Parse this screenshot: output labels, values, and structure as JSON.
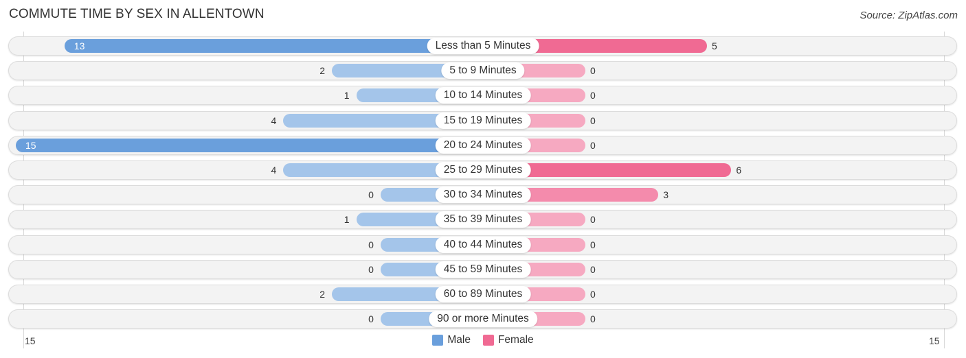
{
  "header": {
    "title": "COMMUTE TIME BY SEX IN ALLENTOWN",
    "source": "Source: ZipAtlas.com"
  },
  "colors": {
    "male": "#6a9fdc",
    "male_light": "#a4c5ea",
    "female": "#f06a93",
    "female_light": "#f6a9c1",
    "row_bg": "#f3f3f3"
  },
  "chart_data": {
    "type": "bar",
    "orientation": "horizontal-diverging",
    "title": "COMMUTE TIME BY SEX IN ALLENTOWN",
    "categories": [
      "Less than 5 Minutes",
      "5 to 9 Minutes",
      "10 to 14 Minutes",
      "15 to 19 Minutes",
      "20 to 24 Minutes",
      "25 to 29 Minutes",
      "30 to 34 Minutes",
      "35 to 39 Minutes",
      "40 to 44 Minutes",
      "45 to 59 Minutes",
      "60 to 89 Minutes",
      "90 or more Minutes"
    ],
    "series": [
      {
        "name": "Male",
        "values": [
          13,
          2,
          1,
          4,
          15,
          4,
          0,
          1,
          0,
          0,
          2,
          0
        ]
      },
      {
        "name": "Female",
        "values": [
          5,
          0,
          0,
          0,
          0,
          6,
          3,
          0,
          0,
          0,
          0,
          0
        ]
      }
    ],
    "xlim": [
      15,
      15
    ],
    "axis_ticks": {
      "left": "15",
      "right": "15"
    },
    "legend": {
      "position": "bottom-center",
      "entries": [
        "Male",
        "Female"
      ]
    },
    "grid": false
  }
}
